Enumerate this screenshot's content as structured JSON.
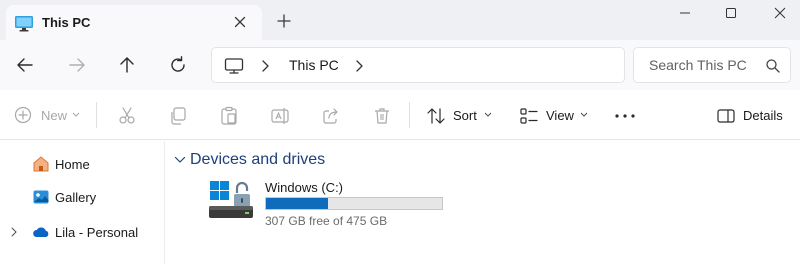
{
  "tab": {
    "title": "This PC",
    "icon": "monitor-icon",
    "close_icon": "close-icon"
  },
  "new_tab_icon": "plus-icon",
  "window_controls": {
    "minimize_icon": "minimize-icon",
    "maximize_icon": "maximize-icon",
    "close_icon": "close-icon"
  },
  "navigation": {
    "back_icon": "arrow-left-icon",
    "forward_icon": "arrow-right-icon",
    "up_icon": "arrow-up-icon",
    "refresh_icon": "refresh-icon"
  },
  "address_bar": {
    "location_icon": "monitor-icon",
    "path": "This PC"
  },
  "search": {
    "placeholder": "Search This PC",
    "icon": "search-icon"
  },
  "command_bar": {
    "new_label": "New",
    "sort_label": "Sort",
    "view_label": "View",
    "details_label": "Details",
    "more_icon": "more-icon",
    "icons": [
      "cut-icon",
      "copy-icon",
      "paste-icon",
      "rename-icon",
      "share-icon",
      "delete-icon"
    ]
  },
  "sidebar": {
    "items": [
      {
        "label": "Home",
        "icon": "home-icon"
      },
      {
        "label": "Gallery",
        "icon": "gallery-icon"
      },
      {
        "label": "Lila - Personal",
        "icon": "onedrive-cloud-icon"
      }
    ]
  },
  "content": {
    "group_header": "Devices and drives",
    "drives": [
      {
        "name": "Windows (C:)",
        "free_text": "307 GB free of 475 GB",
        "used_fraction": 0.354
      }
    ]
  },
  "colors": {
    "accent": "#0f6cbd",
    "header_text": "#1f3f7a",
    "titlebar_bg": "#eef0f4"
  }
}
